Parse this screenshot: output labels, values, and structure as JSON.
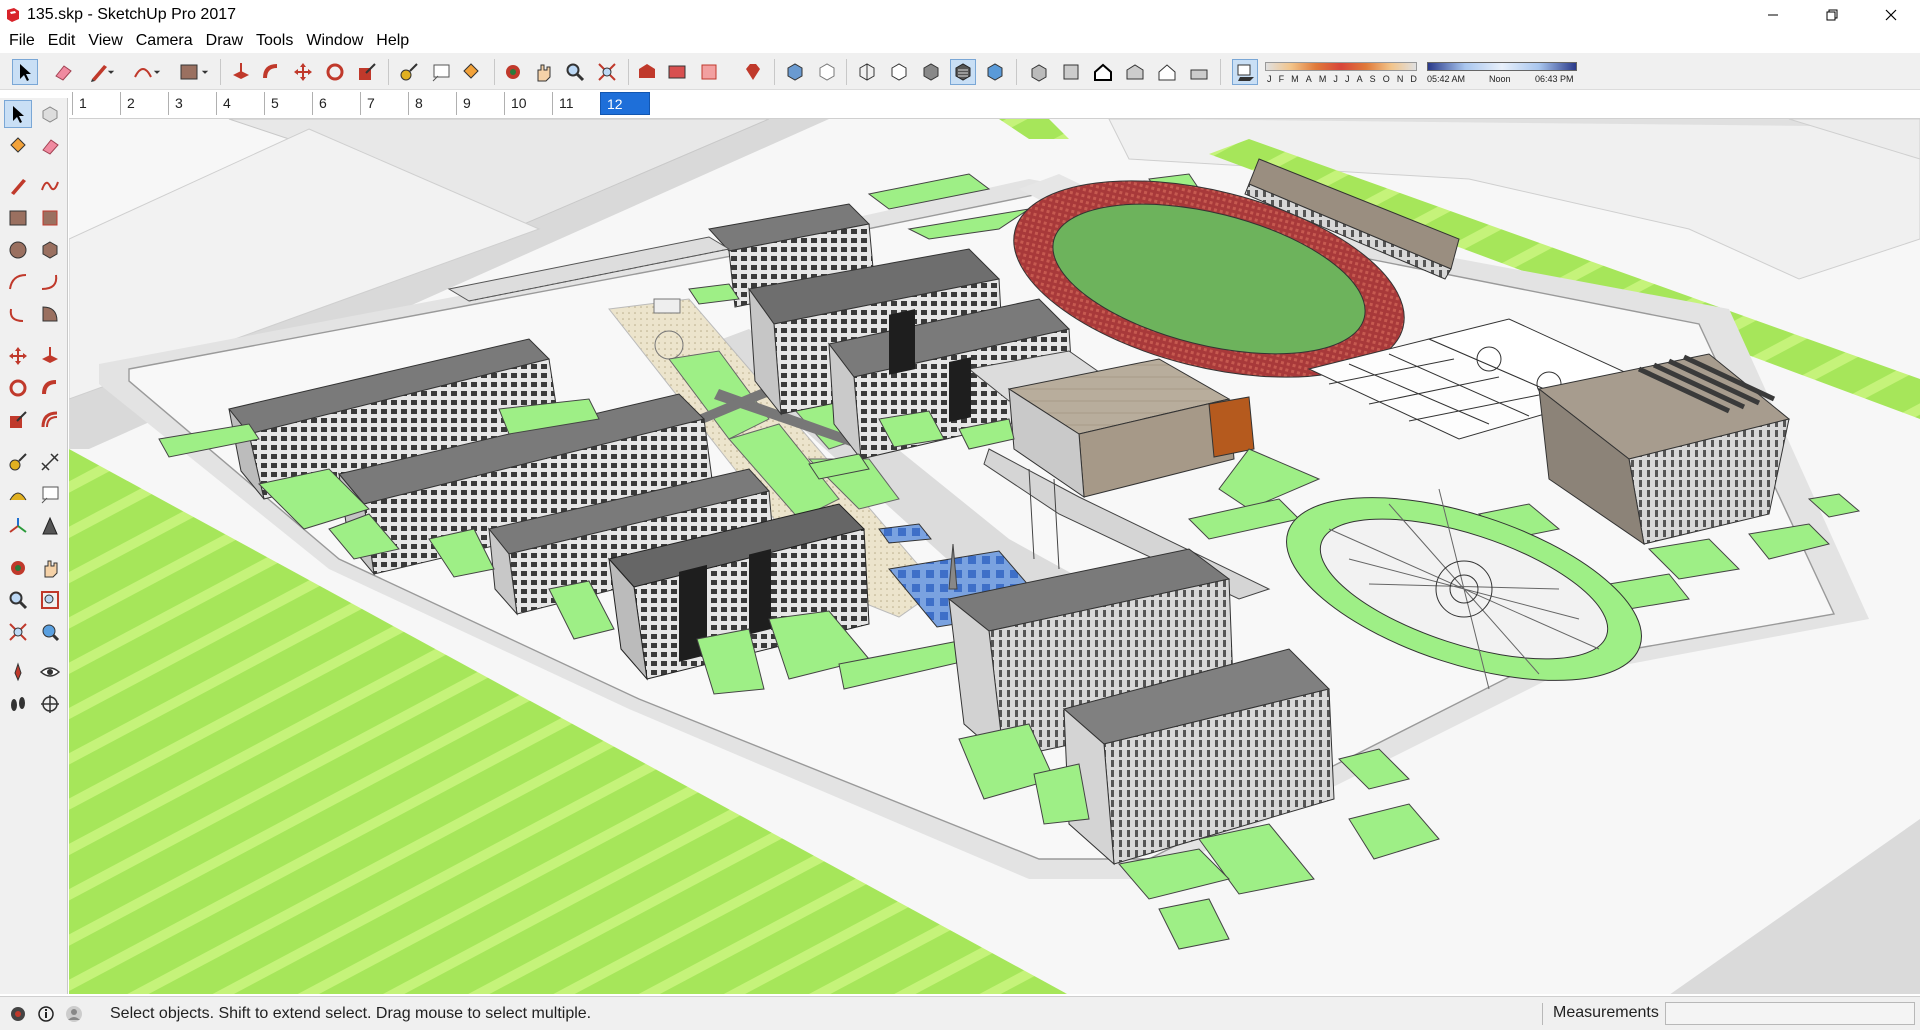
{
  "window": {
    "title": "135.skp - SketchUp Pro 2017",
    "controls": [
      "minimize-icon",
      "restore-icon",
      "close-icon"
    ]
  },
  "menu": {
    "items": [
      "File",
      "Edit",
      "View",
      "Camera",
      "Draw",
      "Tools",
      "Window",
      "Help"
    ]
  },
  "toolbar": {
    "shadow_months": [
      "J",
      "F",
      "M",
      "A",
      "M",
      "J",
      "J",
      "A",
      "S",
      "O",
      "N",
      "D"
    ],
    "time_start": "05:42 AM",
    "time_mid": "Noon",
    "time_end": "06:43 PM"
  },
  "scenes": {
    "tabs": [
      "1",
      "2",
      "3",
      "4",
      "5",
      "6",
      "7",
      "8",
      "9",
      "10",
      "11",
      "12"
    ],
    "active_index": 11
  },
  "status": {
    "message": "Select objects. Shift to extend select. Drag mouse to select multiple.",
    "measurements_label": "Measurements",
    "measurements_value": ""
  },
  "colors": {
    "accent": "#1e6fd9",
    "grass": "#a6e65a",
    "lawn": "#9eef86",
    "track": "#a8393a",
    "field": "#6db35c",
    "road": "#d8d8d8"
  }
}
